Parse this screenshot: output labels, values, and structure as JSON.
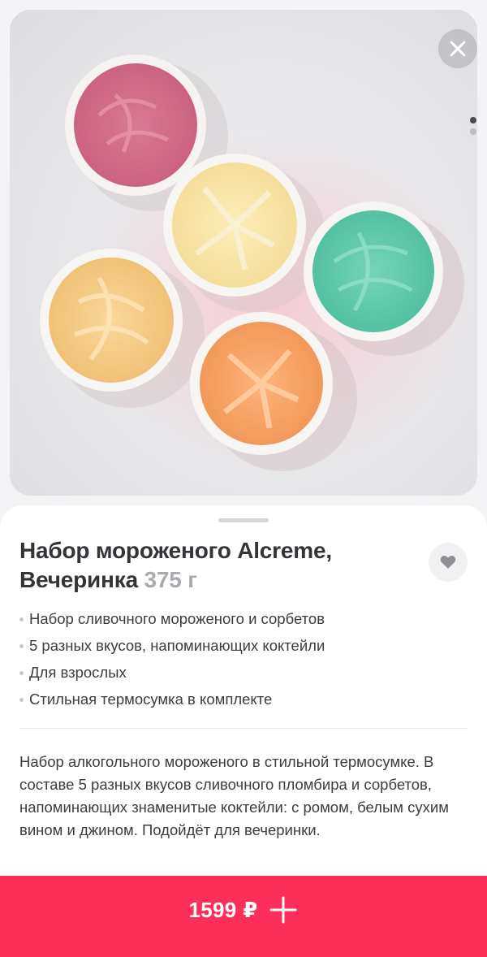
{
  "product": {
    "title": "Набор мороженого Alcreme, Вечеринка",
    "weight": "375 г",
    "bullets": [
      "Набор сливочного мороженого и сорбетов",
      "5 разных вкусов, напоминающих коктейли",
      "Для взрослых",
      "Стильная термосумка в комплекте"
    ],
    "description": "Набор алкогольного мороженого в стильной термосумке. В составе 5 разных вкусов сливочного пломбира и сорбетов, напоминающих знаменитые коктейли: с ромом, белым сухим вином и джином. Подойдёт для вечеринки."
  },
  "gallery": {
    "page_count": 2,
    "active_index": 0
  },
  "cta": {
    "price": "1599 ₽"
  },
  "icons": {
    "close": "close-icon",
    "favorite": "heart-icon",
    "add": "plus-icon"
  },
  "colors": {
    "accent": "#fc2e5a",
    "title": "#333338",
    "weight": "#a9a9ae",
    "text": "#3c3c42"
  }
}
